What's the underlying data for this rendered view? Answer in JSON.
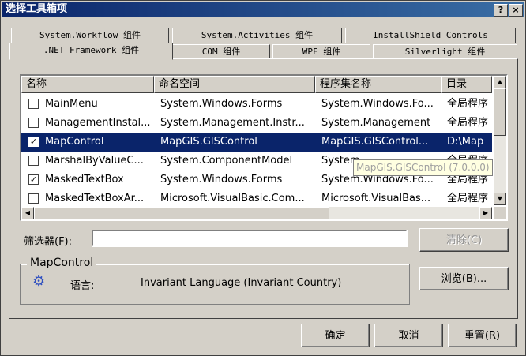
{
  "window": {
    "title": "选择工具箱项",
    "help_btn": "?",
    "close_btn": "×"
  },
  "tabs_back": [
    "System.Workflow 组件",
    "System.Activities 组件",
    "InstallShield Controls"
  ],
  "tabs_front": [
    ".NET Framework 组件",
    "COM 组件",
    "WPF 组件",
    "Silverlight 组件"
  ],
  "columns": [
    "名称",
    "命名空间",
    "程序集名称",
    "目录"
  ],
  "rows": [
    {
      "checked": false,
      "name": "MainMenu",
      "namespace": "System.Windows.Forms",
      "assembly": "System.Windows.Fo...",
      "dir": "全局程序",
      "selected": false
    },
    {
      "checked": false,
      "name": "ManagementInstal...",
      "namespace": "System.Management.Instr...",
      "assembly": "System.Management",
      "dir": "全局程序",
      "selected": false
    },
    {
      "checked": true,
      "name": "MapControl",
      "namespace": "MapGIS.GISControl",
      "assembly": "MapGIS.GISControl...",
      "dir": "D:\\Map",
      "selected": true
    },
    {
      "checked": false,
      "name": "MarshalByValueC...",
      "namespace": "System.ComponentModel",
      "assembly": "System",
      "dir": "全局程序",
      "selected": false
    },
    {
      "checked": true,
      "name": "MaskedTextBox",
      "namespace": "System.Windows.Forms",
      "assembly": "System.Windows.Fo...",
      "dir": "全局程序",
      "selected": false
    },
    {
      "checked": false,
      "name": "MaskedTextBoxAr...",
      "namespace": "Microsoft.VisualBasic.Com...",
      "assembly": "Microsoft.VisualBas...",
      "dir": "全局程序",
      "selected": false
    }
  ],
  "tooltip": "MapGIS.GISControl (7.0.0.0)",
  "filter": {
    "label": "筛选器(F):",
    "value": ""
  },
  "clear_btn": "清除(C)",
  "browse_btn": "浏览(B)...",
  "group": {
    "title": "MapControl",
    "lang_label": "语言:",
    "lang_value": "Invariant Language (Invariant Country)"
  },
  "footer": {
    "ok": "确定",
    "cancel": "取消",
    "reset": "重置(R)"
  }
}
